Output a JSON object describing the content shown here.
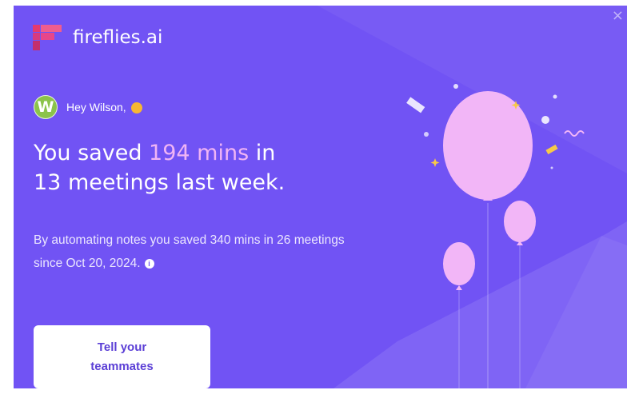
{
  "brand": {
    "name": "fireflies.ai"
  },
  "user": {
    "initial": "W",
    "greeting": "Hey Wilson,"
  },
  "headline": {
    "part1": "You saved ",
    "highlight": "194 mins",
    "part2": " in",
    "line2": "13 meetings last week."
  },
  "subtext": "By automating notes you saved 340 mins in 26 meetings since Oct 20, 2024.",
  "cta": {
    "label": "Tell your teammates"
  },
  "icons": {
    "close": "×",
    "info": "i"
  },
  "colors": {
    "background": "#7153f4",
    "highlight": "#f0b4f5",
    "avatar": "#8bc34a",
    "button_text": "#5b3fd6"
  }
}
